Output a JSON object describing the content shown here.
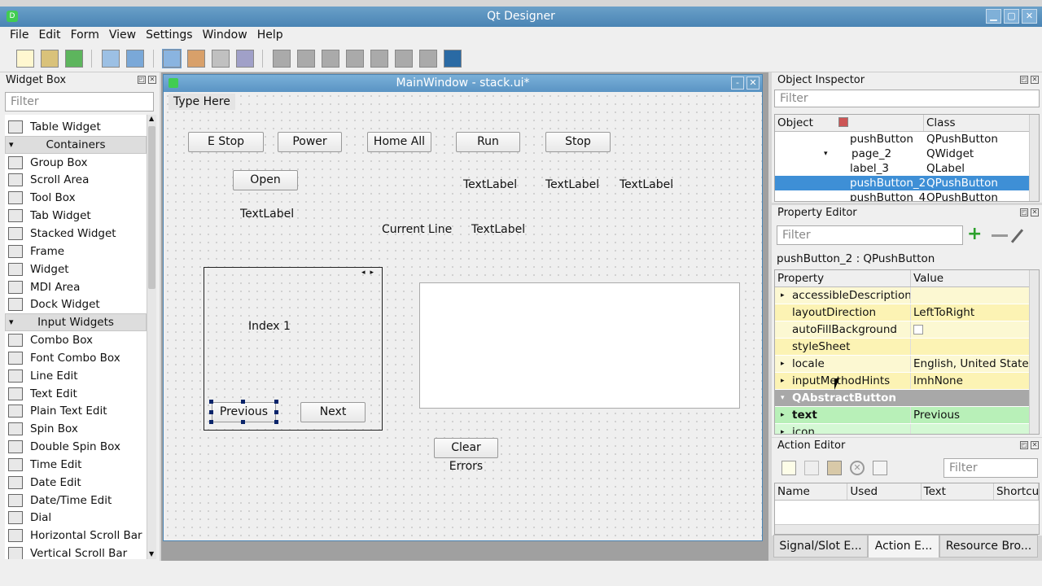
{
  "app": {
    "title": "Qt Designer",
    "icon_label": "D"
  },
  "menu": [
    "File",
    "Edit",
    "Form",
    "View",
    "Settings",
    "Window",
    "Help"
  ],
  "toolbar_icons": [
    "new-form-icon",
    "open-icon",
    "save-icon",
    "send-to-back-icon",
    "bring-to-front-icon",
    "edit-widgets-icon",
    "edit-signals-icon",
    "edit-buddies-icon",
    "edit-tab-order-icon",
    "layout-horizontal-icon",
    "layout-vertical-icon",
    "layout-h-splitter-icon",
    "layout-v-splitter-icon",
    "layout-grid-icon",
    "layout-form-icon",
    "break-layout-icon",
    "adjust-size-icon"
  ],
  "widget_box": {
    "title": "Widget Box",
    "filter_placeholder": "Filter",
    "items": [
      {
        "type": "item",
        "label": "Table Widget",
        "icon": "table-widget-icon"
      },
      {
        "type": "cat",
        "label": "Containers"
      },
      {
        "type": "item",
        "label": "Group Box",
        "icon": "group-box-icon"
      },
      {
        "type": "item",
        "label": "Scroll Area",
        "icon": "scroll-area-icon"
      },
      {
        "type": "item",
        "label": "Tool Box",
        "icon": "tool-box-icon"
      },
      {
        "type": "item",
        "label": "Tab Widget",
        "icon": "tab-widget-icon"
      },
      {
        "type": "item",
        "label": "Stacked Widget",
        "icon": "stacked-widget-icon"
      },
      {
        "type": "item",
        "label": "Frame",
        "icon": "frame-icon"
      },
      {
        "type": "item",
        "label": "Widget",
        "icon": "widget-icon"
      },
      {
        "type": "item",
        "label": "MDI Area",
        "icon": "mdi-area-icon"
      },
      {
        "type": "item",
        "label": "Dock Widget",
        "icon": "dock-widget-icon"
      },
      {
        "type": "cat",
        "label": "Input Widgets"
      },
      {
        "type": "item",
        "label": "Combo Box",
        "icon": "combo-box-icon"
      },
      {
        "type": "item",
        "label": "Font Combo Box",
        "icon": "font-combo-box-icon"
      },
      {
        "type": "item",
        "label": "Line Edit",
        "icon": "line-edit-icon"
      },
      {
        "type": "item",
        "label": "Text Edit",
        "icon": "text-edit-icon"
      },
      {
        "type": "item",
        "label": "Plain Text Edit",
        "icon": "plain-text-edit-icon"
      },
      {
        "type": "item",
        "label": "Spin Box",
        "icon": "spin-box-icon"
      },
      {
        "type": "item",
        "label": "Double Spin Box",
        "icon": "double-spin-box-icon"
      },
      {
        "type": "item",
        "label": "Time Edit",
        "icon": "time-edit-icon"
      },
      {
        "type": "item",
        "label": "Date Edit",
        "icon": "date-edit-icon"
      },
      {
        "type": "item",
        "label": "Date/Time Edit",
        "icon": "datetime-edit-icon"
      },
      {
        "type": "item",
        "label": "Dial",
        "icon": "dial-icon"
      },
      {
        "type": "item",
        "label": "Horizontal Scroll Bar",
        "icon": "hscrollbar-icon"
      },
      {
        "type": "item",
        "label": "Vertical Scroll Bar",
        "icon": "vscrollbar-icon"
      }
    ]
  },
  "form": {
    "title": "MainWindow - stack.ui*",
    "menu_placeholder": "Type Here",
    "buttons": {
      "estop": "E Stop",
      "power": "Power",
      "home_all": "Home All",
      "run": "Run",
      "stop": "Stop",
      "open": "Open",
      "previous": "Previous",
      "next": "Next",
      "clear_errors": "Clear Errors"
    },
    "labels": {
      "label_open": "TextLabel",
      "label_r1": "TextLabel",
      "label_r2": "TextLabel",
      "label_r3": "TextLabel",
      "current_line": "Current Line",
      "label_cl": "TextLabel",
      "index": "Index 1"
    }
  },
  "object_inspector": {
    "title": "Object Inspector",
    "filter_placeholder": "Filter",
    "columns": [
      "Object",
      "Class"
    ],
    "rows": [
      {
        "object": "pushButton",
        "class": "QPushButton",
        "indent": 92,
        "selected": false
      },
      {
        "object": "page_2",
        "class": "QWidget",
        "indent": 92,
        "selected": false,
        "expander": true
      },
      {
        "object": "label_3",
        "class": "QLabel",
        "indent": 92,
        "selected": false
      },
      {
        "object": "pushButton_2",
        "class": "QPushButton",
        "indent": 92,
        "selected": true
      },
      {
        "object": "pushButton_4",
        "class": "QPushButton",
        "indent": 92,
        "selected": false
      }
    ]
  },
  "property_editor": {
    "title": "Property Editor",
    "filter_placeholder": "Filter",
    "selection": "pushButton_2 : QPushButton",
    "columns": [
      "Property",
      "Value"
    ],
    "rows": [
      {
        "name": "accessibleDescription",
        "value": "",
        "bg": "#fcf8d2",
        "arrow": true
      },
      {
        "name": "layoutDirection",
        "value": "LeftToRight",
        "bg": "#fcf3b4",
        "arrow": false
      },
      {
        "name": "autoFillBackground",
        "value": "",
        "bg": "#fcf8d2",
        "arrow": false,
        "checkbox": true
      },
      {
        "name": "styleSheet",
        "value": "",
        "bg": "#fcf3b4",
        "arrow": false
      },
      {
        "name": "locale",
        "value": "English, United States",
        "bg": "#fcf8d2",
        "arrow": true
      },
      {
        "name": "inputMethodHints",
        "value": "ImhNone",
        "bg": "#fcf3b4",
        "arrow": true
      },
      {
        "name": "QAbstractButton",
        "value": "",
        "bg": "#a8a8a8",
        "arrow": true,
        "header": true
      },
      {
        "name": "text",
        "value": "Previous",
        "bg": "#b8f0b8",
        "arrow": true,
        "bold": true
      },
      {
        "name": "icon",
        "value": "",
        "bg": "#d4f8d4",
        "arrow": true
      }
    ]
  },
  "action_editor": {
    "title": "Action Editor",
    "filter_placeholder": "Filter",
    "columns": [
      "Name",
      "Used",
      "Text",
      "Shortcu"
    ]
  },
  "bottom_tabs": [
    {
      "label": "Signal/Slot E...",
      "active": false
    },
    {
      "label": "Action E...",
      "active": true
    },
    {
      "label": "Resource Bro...",
      "active": false
    }
  ]
}
